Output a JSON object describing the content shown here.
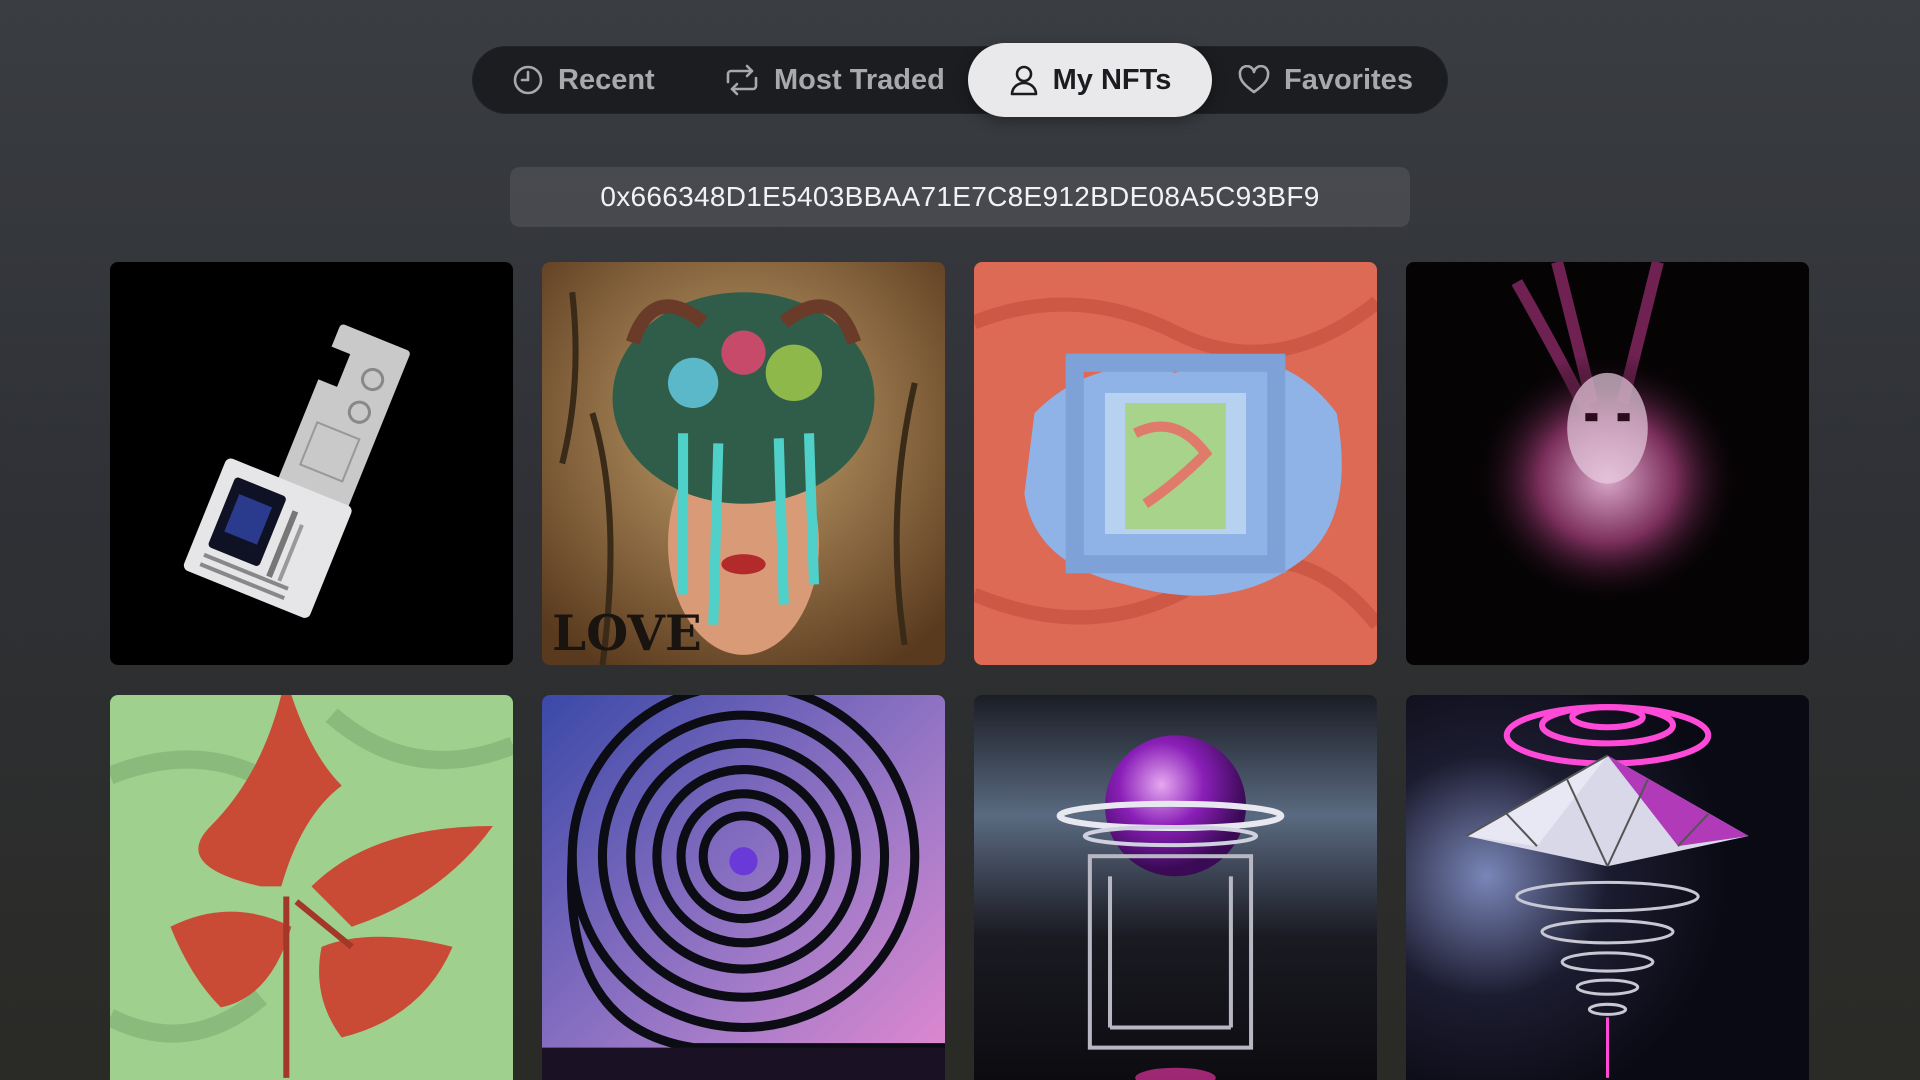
{
  "tabs": {
    "recent": "Recent",
    "most_traded": "Most Traded",
    "my_nfts": "My NFTs",
    "favorites": "Favorites",
    "selected": "My NFTs"
  },
  "wallet": {
    "address": "0x666348D1E5403BBAA71E7C8E912BDE08A5C93BF9"
  },
  "colors": {
    "tab_selected_bg": "#e9e9eb",
    "tabbar_bg": "#1c1d20",
    "text_muted": "#a8a9ad"
  },
  "nfts": [
    {
      "artwork": "access-key-device-on-black"
    },
    {
      "artwork": "woman-portrait-with-floral-headdress"
    },
    {
      "artwork": "red-blue-abstract-frames"
    },
    {
      "artwork": "pink-smoke-face-on-black"
    },
    {
      "artwork": "red-silk-shape-on-green"
    },
    {
      "artwork": "black-spiral-on-purple"
    },
    {
      "artwork": "purple-sphere-on-wire-stand"
    },
    {
      "artwork": "neon-triangle-pyramid-with-rings"
    }
  ]
}
